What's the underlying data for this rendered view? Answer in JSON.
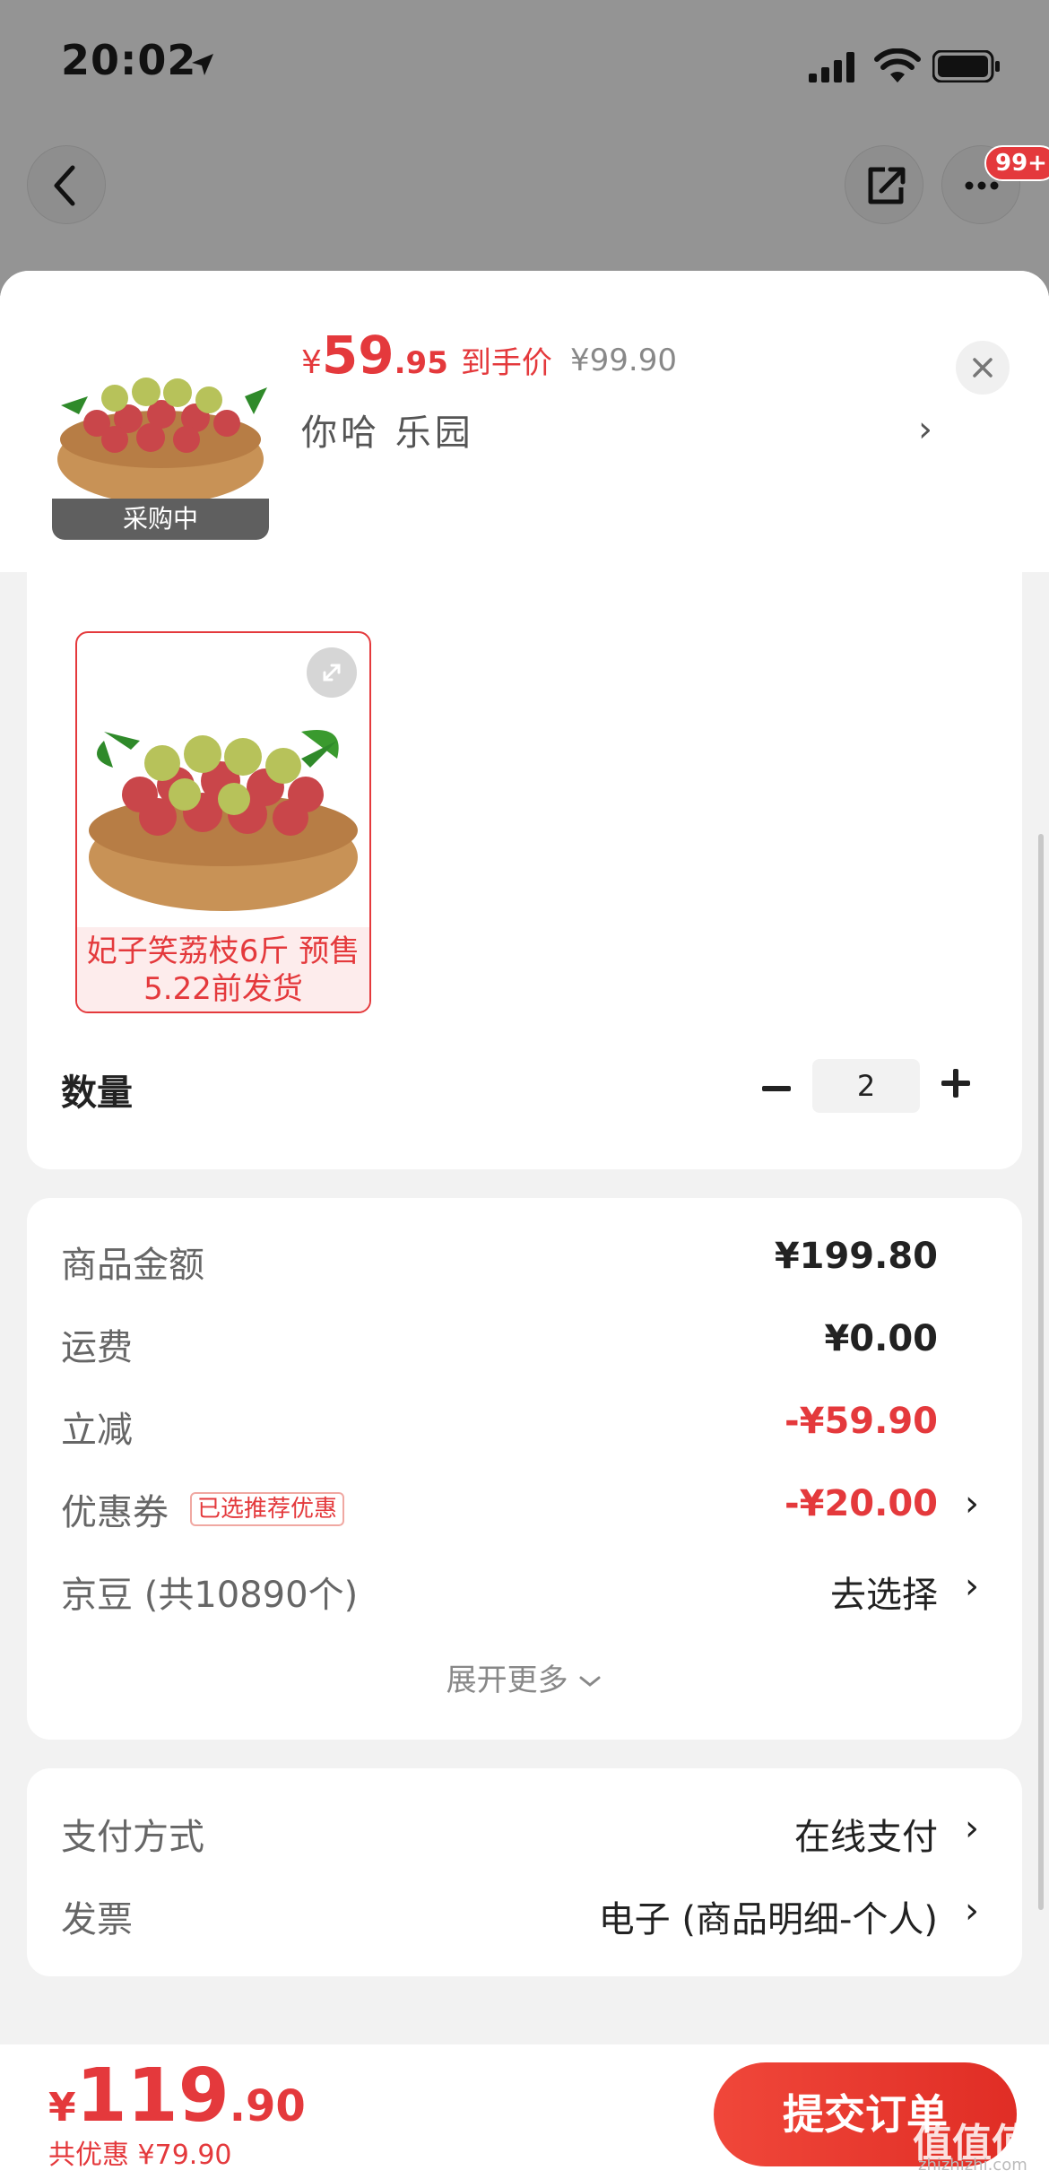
{
  "status_bar": {
    "time": "20:02"
  },
  "nav": {
    "badge": "99+"
  },
  "product": {
    "thumb_tag": "采购中",
    "price_currency": "¥",
    "price_int": "59",
    "price_dec": ".95",
    "price_label": "到手价",
    "original_price": "¥99.90",
    "shop_name": "你哈  乐园"
  },
  "spec": {
    "variant_label": "妃子笑荔枝6斤 预售5.22前发货",
    "quantity_label": "数量",
    "quantity": "2"
  },
  "summary": {
    "rows": [
      {
        "label": "商品金额",
        "value": "¥199.80"
      },
      {
        "label": "运费",
        "value": "¥0.00"
      },
      {
        "label": "立减",
        "value": "-¥59.90"
      },
      {
        "label": "优惠券",
        "tag": "已选推荐优惠",
        "value": "-¥20.00"
      },
      {
        "label": "京豆 (共10890个)",
        "value": "去选择"
      }
    ],
    "expand_more": "展开更多"
  },
  "payment": {
    "rows": [
      {
        "label": "支付方式",
        "value": "在线支付"
      },
      {
        "label": "发票",
        "value": "电子 (商品明细-个人)"
      }
    ]
  },
  "footer": {
    "total_currency": "¥",
    "total_int": "119",
    "total_dec": ".90",
    "saved": "共优惠 ¥79.90",
    "submit": "提交订单",
    "watermark": "值值值",
    "watermark_sub": "zhizhizhi.com"
  },
  "colors": {
    "accent": "#e4393c",
    "dim_overlay": "#949494"
  }
}
